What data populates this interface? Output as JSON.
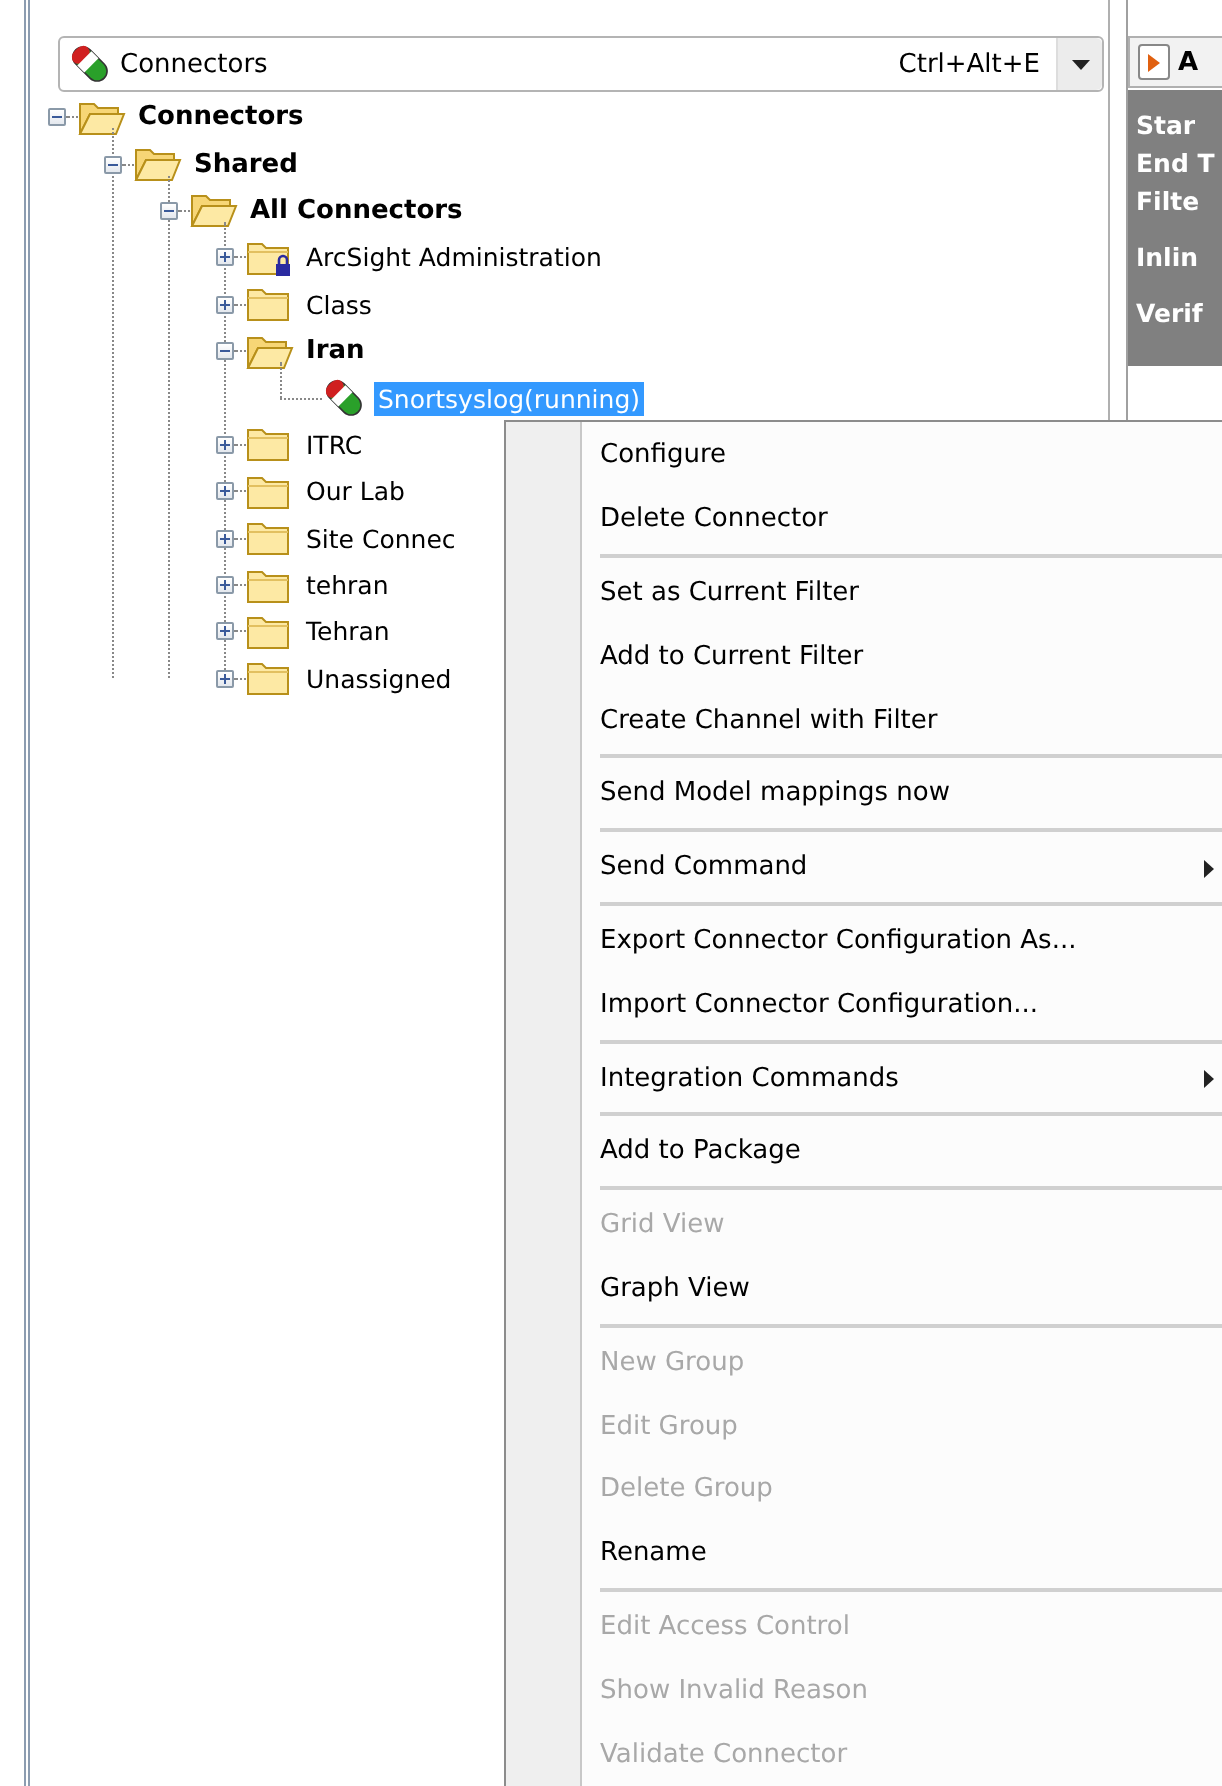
{
  "tree_selector": {
    "label": "Connectors",
    "shortcut": "Ctrl+Alt+E"
  },
  "tree": [
    {
      "label": "Connectors",
      "kind": "folder",
      "expanded": true,
      "locked": false,
      "selected": false,
      "children": [
        {
          "label": "Shared",
          "kind": "folder",
          "expanded": true,
          "locked": false,
          "selected": false,
          "children": [
            {
              "label": "All Connectors",
              "kind": "folder",
              "expanded": true,
              "locked": false,
              "selected": false,
              "children": [
                {
                  "label": "ArcSight Administration",
                  "kind": "folder",
                  "expanded": false,
                  "locked": true,
                  "selected": false
                },
                {
                  "label": "Class",
                  "kind": "folder",
                  "expanded": false,
                  "locked": false,
                  "selected": false
                },
                {
                  "label": "Iran",
                  "kind": "folder",
                  "expanded": true,
                  "locked": false,
                  "selected": false,
                  "children": [
                    {
                      "label": "Snortsyslog(running)",
                      "kind": "connector",
                      "locked": false,
                      "selected": true
                    }
                  ]
                },
                {
                  "label": "ITRC",
                  "kind": "folder",
                  "expanded": false,
                  "locked": false,
                  "selected": false
                },
                {
                  "label": "Our Lab",
                  "kind": "folder",
                  "expanded": false,
                  "locked": false,
                  "selected": false
                },
                {
                  "label": "Site Connec",
                  "kind": "folder",
                  "expanded": false,
                  "locked": false,
                  "selected": false
                },
                {
                  "label": "tehran",
                  "kind": "folder",
                  "expanded": false,
                  "locked": false,
                  "selected": false
                },
                {
                  "label": "Tehran",
                  "kind": "folder",
                  "expanded": false,
                  "locked": false,
                  "selected": false
                },
                {
                  "label": "Unassigned",
                  "kind": "folder",
                  "expanded": false,
                  "locked": false,
                  "selected": false
                }
              ]
            }
          ]
        }
      ]
    }
  ],
  "side_panel": {
    "header": "A",
    "fields": [
      "Star",
      "End T",
      "Filte",
      "Inlin",
      "Verif"
    ]
  },
  "context_menu": [
    {
      "kind": "item",
      "label": "Configure",
      "disabled": false,
      "submenu": false
    },
    {
      "kind": "item",
      "label": "Delete Connector",
      "disabled": false,
      "submenu": false
    },
    {
      "kind": "separator"
    },
    {
      "kind": "item",
      "label": "Set as Current Filter",
      "disabled": false,
      "submenu": false
    },
    {
      "kind": "item",
      "label": "Add to Current Filter",
      "disabled": false,
      "submenu": false
    },
    {
      "kind": "item",
      "label": "Create Channel with Filter",
      "disabled": false,
      "submenu": false
    },
    {
      "kind": "separator"
    },
    {
      "kind": "item",
      "label": "Send Model mappings now",
      "disabled": false,
      "submenu": false
    },
    {
      "kind": "separator"
    },
    {
      "kind": "item",
      "label": "Send Command",
      "disabled": false,
      "submenu": true
    },
    {
      "kind": "separator"
    },
    {
      "kind": "item",
      "label": "Export Connector Configuration As...",
      "disabled": false,
      "submenu": false
    },
    {
      "kind": "item",
      "label": "Import Connector Configuration...",
      "disabled": false,
      "submenu": false
    },
    {
      "kind": "separator"
    },
    {
      "kind": "item",
      "label": "Integration Commands",
      "disabled": false,
      "submenu": true
    },
    {
      "kind": "separator"
    },
    {
      "kind": "item",
      "label": "Add to Package",
      "disabled": false,
      "submenu": false
    },
    {
      "kind": "separator"
    },
    {
      "kind": "item",
      "label": "Grid View",
      "disabled": true,
      "submenu": false
    },
    {
      "kind": "item",
      "label": "Graph View",
      "disabled": false,
      "submenu": false
    },
    {
      "kind": "separator"
    },
    {
      "kind": "item",
      "label": "New Group",
      "disabled": true,
      "submenu": false
    },
    {
      "kind": "item",
      "label": "Edit Group",
      "disabled": true,
      "submenu": false
    },
    {
      "kind": "item",
      "label": "Delete Group",
      "disabled": true,
      "submenu": false
    },
    {
      "kind": "item",
      "label": "Rename",
      "disabled": false,
      "submenu": false
    },
    {
      "kind": "separator"
    },
    {
      "kind": "item",
      "label": "Edit Access Control",
      "disabled": true,
      "submenu": false
    },
    {
      "kind": "item",
      "label": "Show Invalid Reason",
      "disabled": true,
      "submenu": false
    },
    {
      "kind": "item",
      "label": "Validate Connector",
      "disabled": true,
      "submenu": false
    }
  ]
}
